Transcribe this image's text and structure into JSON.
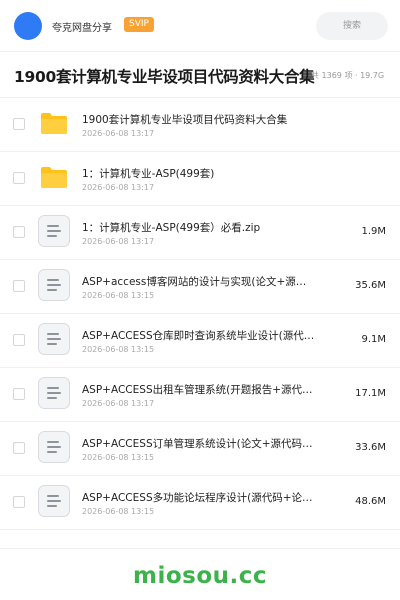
{
  "header": {
    "username": "夸克网盘分享",
    "badge": "SVIP",
    "search_placeholder": "搜索"
  },
  "share": {
    "title": "1900套计算机专业毕设项目代码资料大合集",
    "meta": "共 1369 项 · 19.7G"
  },
  "files": [
    {
      "type": "folder",
      "icon": "folder-icon",
      "name": "1900套计算机专业毕设项目代码资料大合集",
      "date": "2026-06-08 13:17",
      "size": ""
    },
    {
      "type": "folder",
      "icon": "folder-icon",
      "name": "1：计算机专业-ASP(499套)",
      "date": "2026-06-08 13:17",
      "size": ""
    },
    {
      "type": "file",
      "icon": "document-icon",
      "name": "1：计算机专业-ASP(499套）必看.zip",
      "date": "2026-06-08 13:17",
      "size": "1.9M"
    },
    {
      "type": "file",
      "icon": "document-icon",
      "name": "ASP+access博客网站的设计与实现(论文+源…",
      "date": "2026-06-08 13:15",
      "size": "35.6M"
    },
    {
      "type": "file",
      "icon": "document-icon",
      "name": "ASP+ACCESS仓库即时查询系统毕业设计(源代…",
      "date": "2026-06-08 13:15",
      "size": "9.1M"
    },
    {
      "type": "file",
      "icon": "document-icon",
      "name": "ASP+ACCESS出租车管理系统(开题报告+源代…",
      "date": "2026-06-08 13:17",
      "size": "17.1M"
    },
    {
      "type": "file",
      "icon": "document-icon",
      "name": "ASP+ACCESS订单管理系统设计(论文+源代码…",
      "date": "2026-06-08 13:15",
      "size": "33.6M"
    },
    {
      "type": "file",
      "icon": "document-icon",
      "name": "ASP+ACCESS多功能论坛程序设计(源代码+论…",
      "date": "2026-06-08 13:15",
      "size": "48.6M"
    }
  ],
  "footer": {
    "brand": "miosou.cc"
  },
  "colors": {
    "avatar": "#2f7bf5",
    "badge": "#f7a233",
    "folder": "#ffc21a",
    "brand": "#3cb34a"
  }
}
